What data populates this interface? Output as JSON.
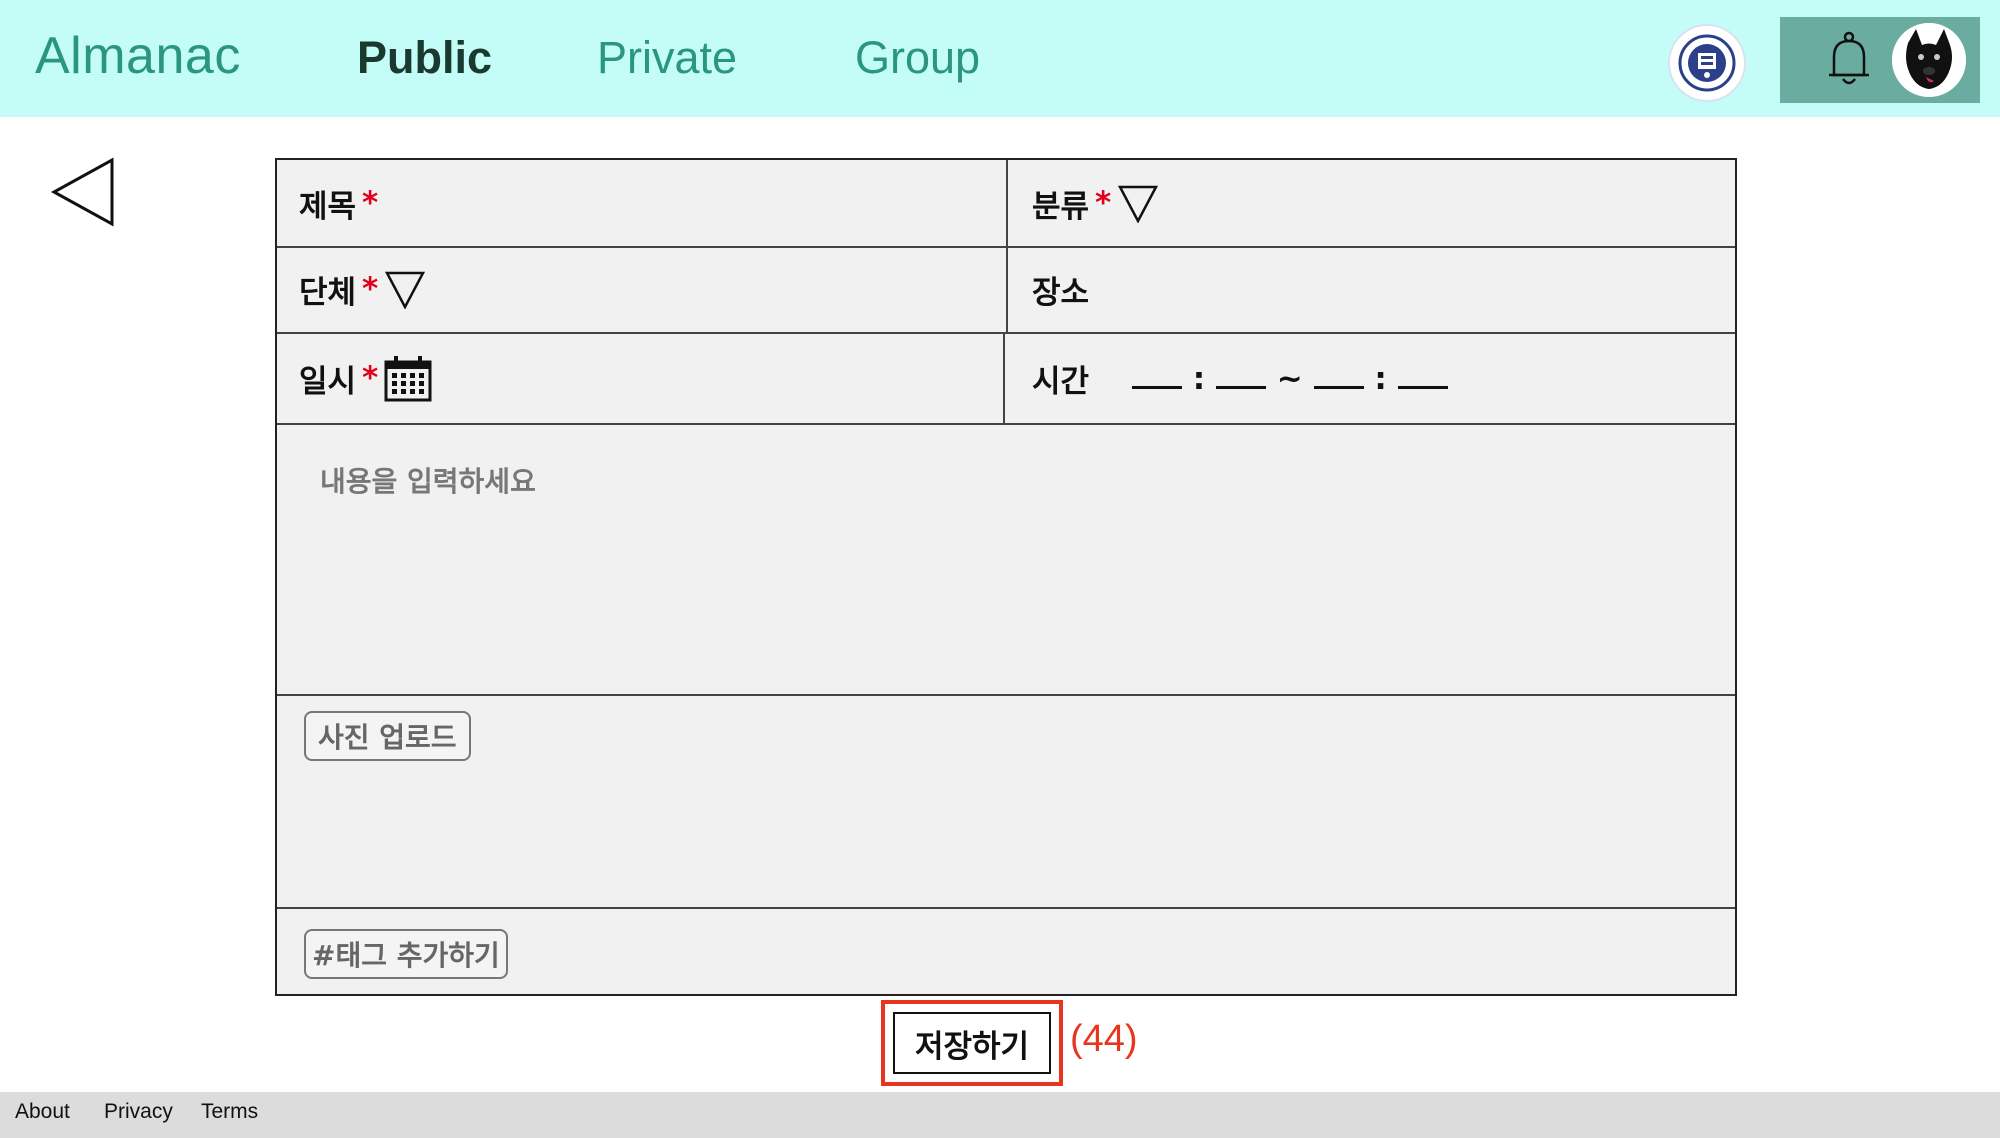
{
  "header": {
    "brand": "Almanac",
    "nav": [
      "Public",
      "Private",
      "Group"
    ],
    "active_nav": "Public",
    "colors": {
      "bar": "#c4fdf7",
      "accent": "#2a9680",
      "action_box": "#6aada0"
    }
  },
  "form": {
    "title_label": "제목",
    "category_label": "분류",
    "group_label": "단체",
    "place_label": "장소",
    "date_label": "일시",
    "time_label": "시간",
    "required_mark": "*",
    "time_sep_colon": ":",
    "time_sep_tilde": "~",
    "content_placeholder": "내용을 입력하세요",
    "photo_upload_label": "사진 업로드",
    "add_tag_label": "#태그 추가하기"
  },
  "save": {
    "label": "저장하기",
    "annotation": "(44)"
  },
  "footer": {
    "links": [
      "About",
      "Privacy",
      "Terms"
    ]
  }
}
